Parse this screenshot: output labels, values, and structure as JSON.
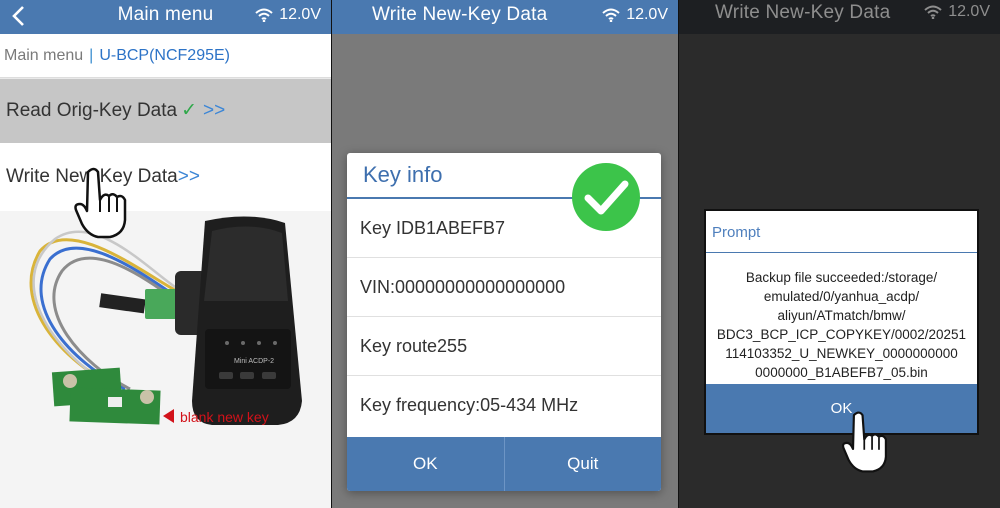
{
  "status": {
    "voltage": "12.0V"
  },
  "panel1": {
    "title": "Main menu",
    "breadcrumb_root": "Main menu",
    "breadcrumb_separator": "|",
    "breadcrumb_current": "U-BCP(NCF295E)",
    "item_read": "Read Orig-Key Data",
    "item_read_check": "✓",
    "item_read_arrows": ">>",
    "item_write": "Write New-Key Data",
    "item_write_arrows": ">>",
    "photo_caption": "blank new key",
    "device_label": "Mini ACDP-2"
  },
  "panel2": {
    "title": "Write New-Key Data",
    "dialog_title": "Key info",
    "rows": [
      "Key IDB1ABEFB7",
      "VIN:00000000000000000",
      "Key route255",
      "Key frequency:05-434 MHz"
    ],
    "ok": "OK",
    "quit": "Quit"
  },
  "panel3": {
    "title": "Write New-Key Data",
    "prompt_title": "Prompt",
    "message_lines": [
      "Backup file succeeded:/storage/",
      "emulated/0/yanhua_acdp/",
      "aliyun/ATmatch/bmw/",
      "BDC3_BCP_ICP_COPYKEY/0002/20251",
      "114103352_U_NEWKEY_0000000000",
      "0000000_B1ABEFB7_05.bin"
    ],
    "ok": "OK"
  },
  "colors": {
    "titlebar": "#4a79b0",
    "check": "#2fa84a",
    "caption": "#d2121a",
    "success_badge": "#3cc44a"
  }
}
